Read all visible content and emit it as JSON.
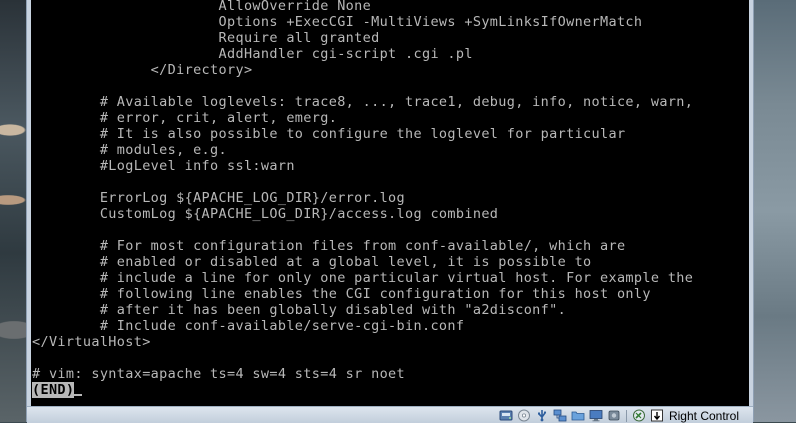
{
  "terminal": {
    "lines": [
      "                      AllowOverride None",
      "                      Options +ExecCGI -MultiViews +SymLinksIfOwnerMatch",
      "                      Require all granted",
      "                      AddHandler cgi-script .cgi .pl",
      "              </Directory>",
      "",
      "        # Available loglevels: trace8, ..., trace1, debug, info, notice, warn,",
      "        # error, crit, alert, emerg.",
      "        # It is also possible to configure the loglevel for particular",
      "        # modules, e.g.",
      "        #LogLevel info ssl:warn",
      "",
      "        ErrorLog ${APACHE_LOG_DIR}/error.log",
      "        CustomLog ${APACHE_LOG_DIR}/access.log combined",
      "",
      "        # For most configuration files from conf-available/, which are",
      "        # enabled or disabled at a global level, it is possible to",
      "        # include a line for only one particular virtual host. For example the",
      "        # following line enables the CGI configuration for this host only",
      "        # after it has been globally disabled with \"a2disconf\".",
      "        # Include conf-available/serve-cgi-bin.conf",
      "</VirtualHost>",
      "",
      "# vim: syntax=apache ts=4 sw=4 sts=4 sr noet"
    ],
    "pager_status": "(END)"
  },
  "statusbar": {
    "icons": [
      "hard-disk-icon",
      "optical-drive-icon",
      "usb-icon",
      "network-icon",
      "shared-folders-icon",
      "display-icon",
      "video-capture-icon",
      "mouse-integration-icon",
      "host-key-arrow-icon"
    ],
    "host_key_label": "Right Control"
  },
  "colors": {
    "terminal_bg": "#000000",
    "terminal_fg": "#b8b8b8",
    "statusbar_bg": "#c8d3e0"
  }
}
